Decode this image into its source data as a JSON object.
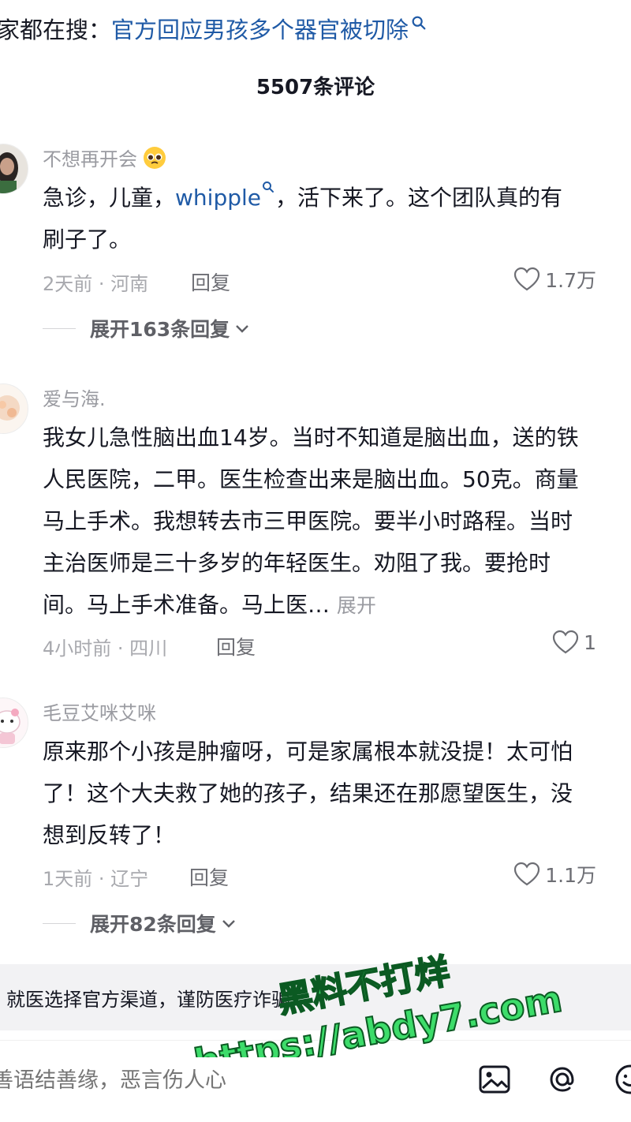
{
  "search_banner": {
    "label": "家都在搜：",
    "topic": "官方回应男孩多个器官被切除"
  },
  "comments_header": {
    "count_text": "5507条评论"
  },
  "comments": [
    {
      "username": "不想再开会",
      "text_lines": [
        {
          "pre": "急诊，儿童，",
          "link": "whipple",
          "post": "，活下来了。这个团队真的有"
        },
        {
          "pre": "刷子了。"
        }
      ],
      "time_location": "2天前 · 河南",
      "reply_label": "回复",
      "likes": "1.7万",
      "expand_replies": "展开163条回复"
    },
    {
      "username": "爱与海.",
      "text_lines": [
        {
          "pre": "我女儿急性脑出血14岁。当时不知道是脑出血，送的铁"
        },
        {
          "pre": "人民医院，二甲。医生检查出来是脑出血。50克。商量"
        },
        {
          "pre": "马上手术。我想转去市三甲医院。要半小时路程。当时"
        },
        {
          "pre": "主治医师是三十多岁的年轻医生。劝阻了我。要抢时"
        },
        {
          "pre": "间。马上手术准备。马上医…"
        }
      ],
      "inline_expand": "展开",
      "time_location": "4小时前 · 四川",
      "reply_label": "回复",
      "likes": "1"
    },
    {
      "username": "毛豆艾咪艾咪",
      "text_lines": [
        {
          "pre": "原来那个小孩是肿瘤呀，可是家属根本就没提！太可怕"
        },
        {
          "pre": "了！这个大夫救了她的孩子，结果还在那愿望医生，没"
        },
        {
          "pre": "想到反转了！"
        }
      ],
      "time_location": "1天前 · 辽宁",
      "reply_label": "回复",
      "likes": "1.1万",
      "expand_replies": "展开82条回复"
    }
  ],
  "notice_bar": {
    "text": "就医选择官方渠道，谨防医疗诈骗"
  },
  "input_bar": {
    "placeholder": "善语结善缘，恶言伤人心"
  },
  "watermark": {
    "line1": "黑料不打烊",
    "line2": "https://abdy7.com"
  },
  "colors": {
    "link_blue": "#1f5aa6",
    "watermark_green": "#3ddc6a"
  }
}
